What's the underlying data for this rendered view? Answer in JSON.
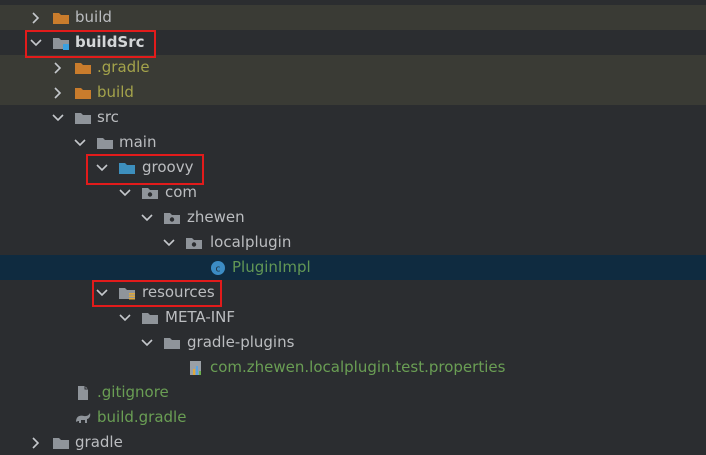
{
  "tree": {
    "items": [
      {
        "label": "build"
      },
      {
        "label": "buildSrc"
      },
      {
        "label": ".gradle"
      },
      {
        "label": "build"
      },
      {
        "label": "src"
      },
      {
        "label": "main"
      },
      {
        "label": "groovy"
      },
      {
        "label": "com"
      },
      {
        "label": "zhewen"
      },
      {
        "label": "localplugin"
      },
      {
        "label": "PluginImpl"
      },
      {
        "label": "resources"
      },
      {
        "label": "META-INF"
      },
      {
        "label": "gradle-plugins"
      },
      {
        "label": "com.zhewen.localplugin.test.properties"
      },
      {
        "label": ".gitignore"
      },
      {
        "label": "build.gradle"
      },
      {
        "label": "gradle"
      }
    ]
  },
  "colors": {
    "background": "#2b2d30",
    "selected_row": "#0f2b40",
    "excluded_row": "#3a3b35",
    "highlight_box": "#e21b1b",
    "folder_orange": "#c97c2c",
    "folder_gray": "#8f949a",
    "folder_blue": "#3d8fbd"
  },
  "icons": [
    "chevron-right-icon",
    "chevron-down-icon",
    "folder-icon",
    "module-folder-icon",
    "source-folder-icon",
    "resources-folder-icon",
    "package-icon",
    "class-icon",
    "properties-file-icon",
    "gitignore-file-icon",
    "gradle-file-icon"
  ]
}
